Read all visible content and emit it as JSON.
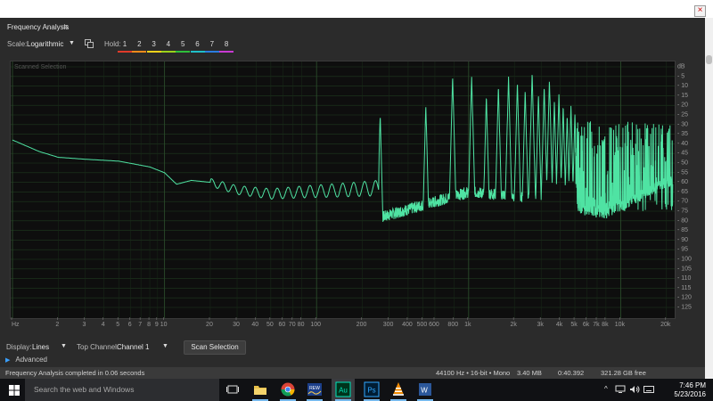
{
  "window": {
    "close_symbol": "×"
  },
  "panel": {
    "title": "Frequency Analysis",
    "menu_symbol": "≡"
  },
  "controls": {
    "scale_label": "Scale:",
    "scale_value": "Logarithmic",
    "hold_label": "Hold:",
    "holds": [
      {
        "label": "1",
        "color": "#e03a2a"
      },
      {
        "label": "2",
        "color": "#f08a1a"
      },
      {
        "label": "3",
        "color": "#f0d21a"
      },
      {
        "label": "4",
        "color": "#9bd21a"
      },
      {
        "label": "5",
        "color": "#2fbf3a"
      },
      {
        "label": "6",
        "color": "#1fbfc8"
      },
      {
        "label": "7",
        "color": "#2a7de0"
      },
      {
        "label": "8",
        "color": "#c83ad2"
      }
    ]
  },
  "plot": {
    "title": "Scanned Selection"
  },
  "chart_data": {
    "type": "line",
    "x_scale": "log",
    "x_range": [
      1,
      22050
    ],
    "y_range": [
      -128,
      0
    ],
    "xlabel": "Hz",
    "ylabel": "dB",
    "x_ticks": [
      {
        "v": 1,
        "label": "Hz"
      },
      {
        "v": 2,
        "label": "2"
      },
      {
        "v": 3,
        "label": "3"
      },
      {
        "v": 4,
        "label": "4"
      },
      {
        "v": 5,
        "label": "5"
      },
      {
        "v": 6,
        "label": "6"
      },
      {
        "v": 7,
        "label": "7"
      },
      {
        "v": 8,
        "label": "8"
      },
      {
        "v": 9,
        "label": "9"
      },
      {
        "v": 10,
        "label": "10"
      },
      {
        "v": 20,
        "label": "20"
      },
      {
        "v": 30,
        "label": "30"
      },
      {
        "v": 40,
        "label": "40"
      },
      {
        "v": 50,
        "label": "50"
      },
      {
        "v": 60,
        "label": "60"
      },
      {
        "v": 70,
        "label": "70"
      },
      {
        "v": 80,
        "label": "80"
      },
      {
        "v": 100,
        "label": "100"
      },
      {
        "v": 200,
        "label": "200"
      },
      {
        "v": 300,
        "label": "300"
      },
      {
        "v": 400,
        "label": "400"
      },
      {
        "v": 500,
        "label": "500"
      },
      {
        "v": 600,
        "label": "600"
      },
      {
        "v": 800,
        "label": "800"
      },
      {
        "v": 1000,
        "label": "1k"
      },
      {
        "v": 2000,
        "label": "2k"
      },
      {
        "v": 3000,
        "label": "3k"
      },
      {
        "v": 4000,
        "label": "4k"
      },
      {
        "v": 5000,
        "label": "5k"
      },
      {
        "v": 6000,
        "label": "6k"
      },
      {
        "v": 7000,
        "label": "7k"
      },
      {
        "v": 8000,
        "label": "8k"
      },
      {
        "v": 10000,
        "label": "10k"
      },
      {
        "v": 20000,
        "label": "20k"
      }
    ],
    "y_ticks": [
      "dB",
      "-5",
      "-10",
      "-15",
      "-20",
      "-25",
      "-30",
      "-35",
      "-40",
      "-45",
      "-50",
      "-55",
      "-60",
      "-65",
      "-70",
      "-75",
      "-80",
      "-85",
      "-90",
      "-95",
      "-100",
      "-105",
      "-110",
      "-115",
      "-120",
      "-125"
    ],
    "baseline": [
      [
        1,
        -38
      ],
      [
        1.5,
        -44
      ],
      [
        2,
        -47
      ],
      [
        3,
        -48
      ],
      [
        5,
        -49
      ],
      [
        8,
        -52
      ],
      [
        10,
        -55
      ],
      [
        12,
        -61
      ],
      [
        15,
        -59
      ],
      [
        20,
        -60
      ],
      [
        30,
        -64
      ],
      [
        50,
        -66
      ],
      [
        80,
        -65
      ],
      [
        150,
        -64
      ],
      [
        250,
        -63
      ]
    ],
    "ripple_range": [
      20,
      260
    ],
    "harmonics": [
      {
        "f": 262,
        "db": -25
      },
      {
        "f": 523,
        "db": -20
      },
      {
        "f": 785,
        "db": -5
      },
      {
        "f": 1047,
        "db": -5
      },
      {
        "f": 1308,
        "db": -15
      },
      {
        "f": 1570,
        "db": -10
      },
      {
        "f": 1830,
        "db": -5
      },
      {
        "f": 2093,
        "db": -8
      },
      {
        "f": 2355,
        "db": -12
      },
      {
        "f": 2616,
        "db": -3
      },
      {
        "f": 2878,
        "db": -15
      },
      {
        "f": 3140,
        "db": -10
      },
      {
        "f": 3400,
        "db": -7
      },
      {
        "f": 3662,
        "db": -18
      },
      {
        "f": 3924,
        "db": -14
      },
      {
        "f": 4186,
        "db": -20
      },
      {
        "f": 4448,
        "db": -25
      },
      {
        "f": 4709,
        "db": -20
      },
      {
        "f": 5000,
        "db": -24
      }
    ],
    "noise_floor": [
      [
        270,
        -78
      ],
      [
        1000,
        -65
      ],
      [
        2000,
        -67
      ],
      [
        4000,
        -72
      ],
      [
        8000,
        -76
      ],
      [
        20000,
        -60
      ]
    ],
    "dense_region": [
      5000,
      22050,
      -75,
      -28
    ]
  },
  "bottom": {
    "display_label": "Display:",
    "display_value": "Lines",
    "top_channel_label": "Top Channel:",
    "top_channel_value": "Channel 1",
    "scan_button": "Scan Selection",
    "advanced": "Advanced"
  },
  "status": {
    "message": "Frequency Analysis completed in 0.06 seconds",
    "format": "44100 Hz • 16-bit • Mono",
    "size": "3.40 MB",
    "duration": "0:40.392",
    "free": "321.28 GB free"
  },
  "taskbar": {
    "search_placeholder": "Search the web and Windows",
    "time": "7:46 PM",
    "date": "5/23/2016",
    "apps": [
      "task-view",
      "file-explorer",
      "chrome",
      "rew",
      "audition",
      "photoshop",
      "vlc",
      "word"
    ]
  }
}
